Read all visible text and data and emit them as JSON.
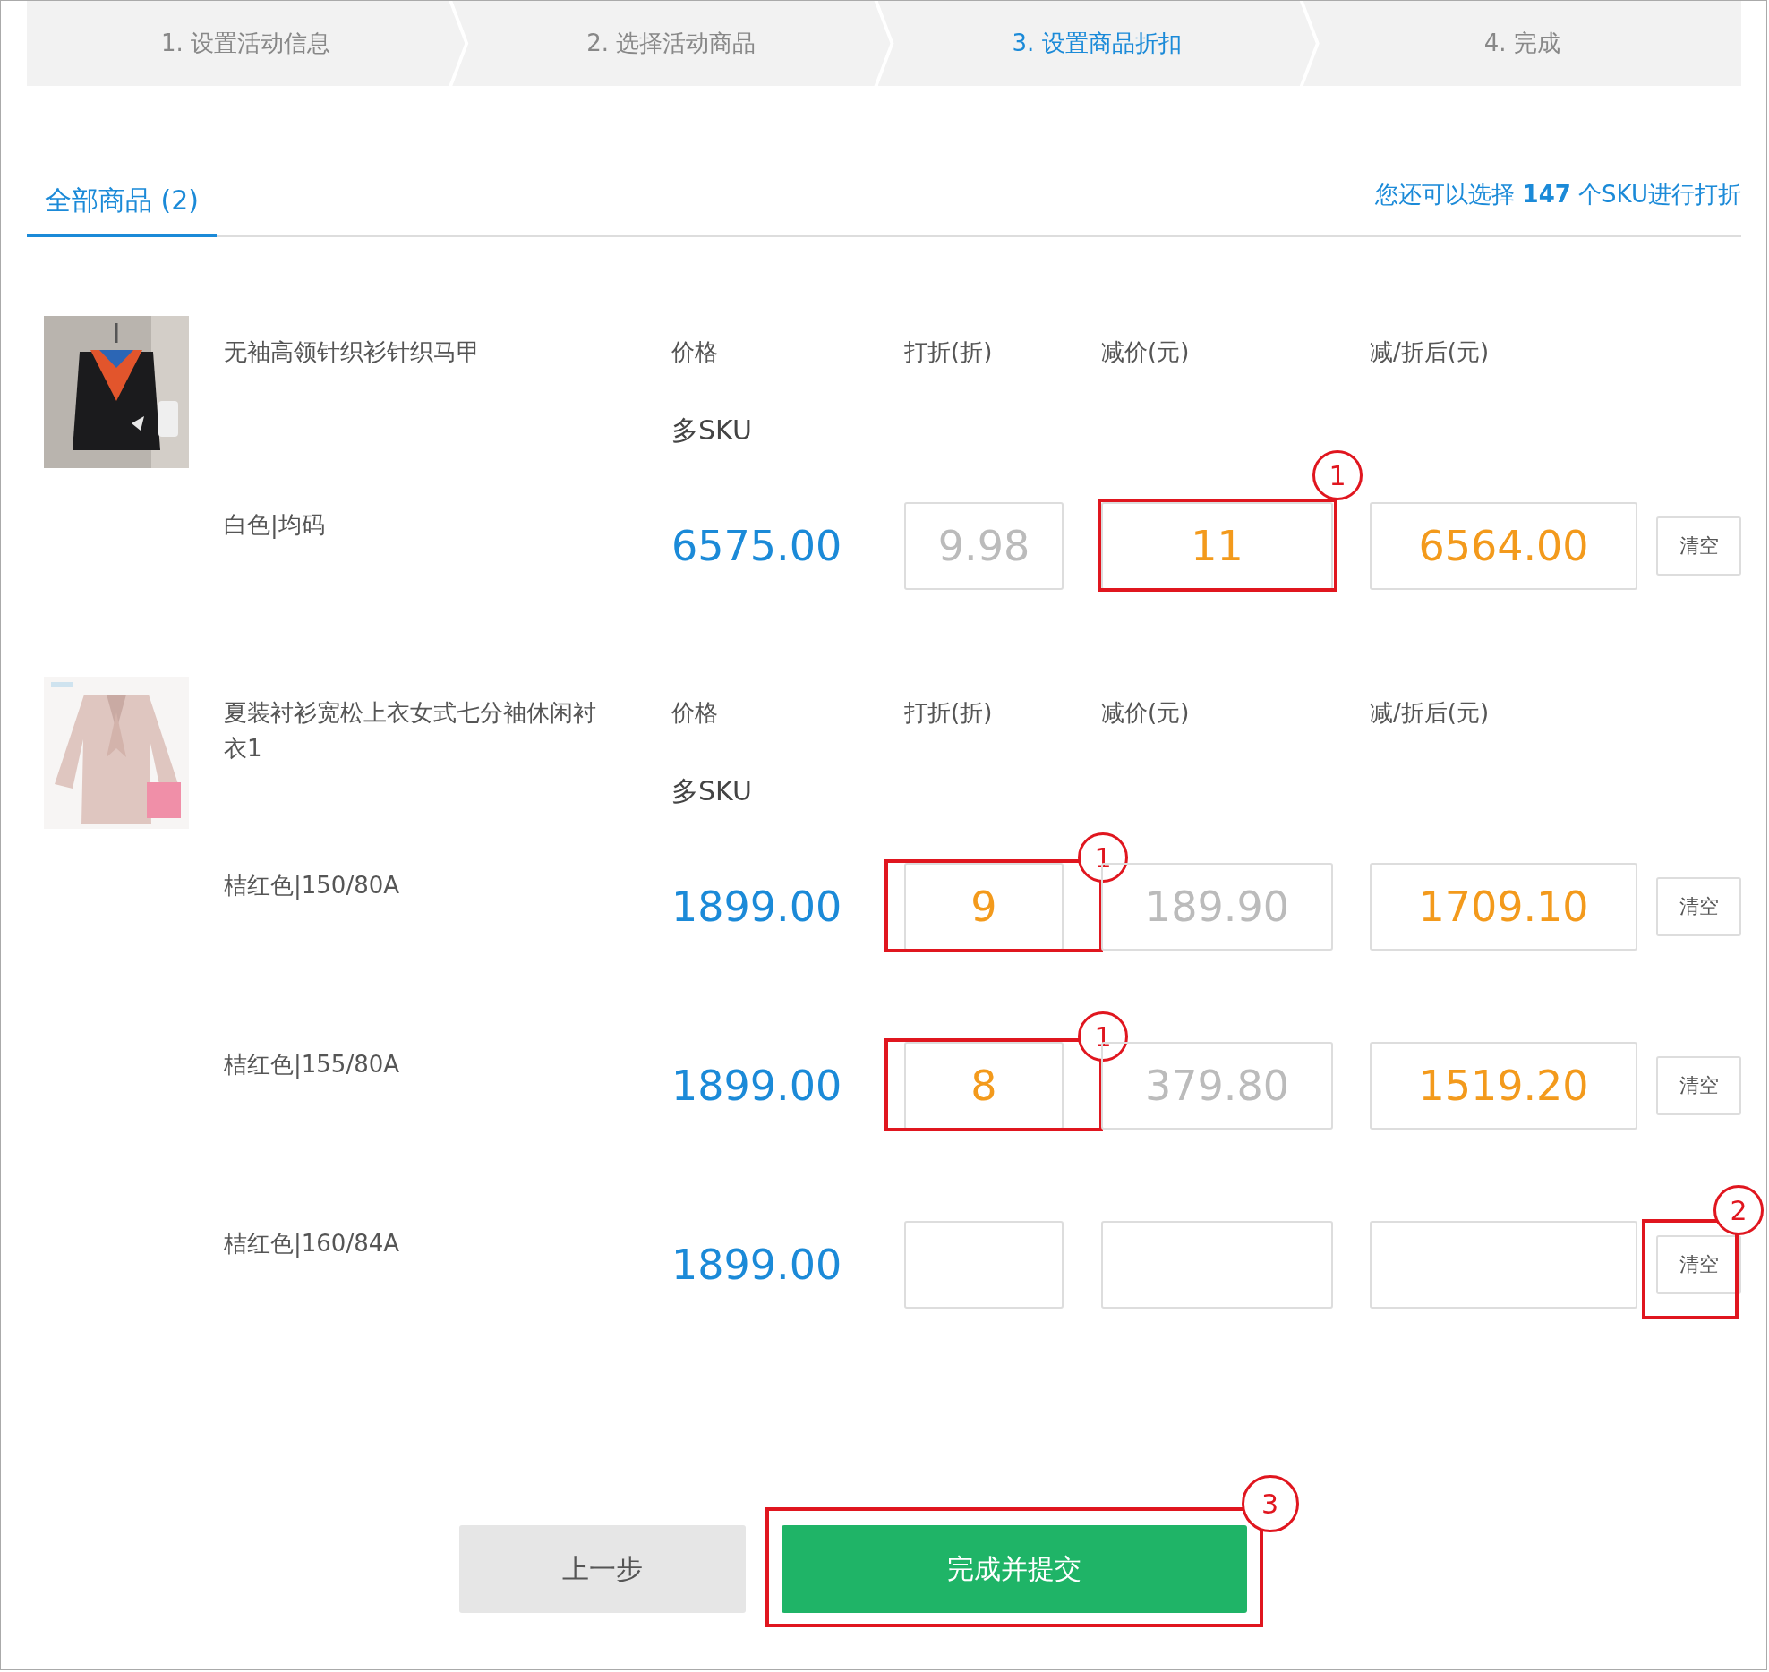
{
  "steps": [
    {
      "label": "1. 设置活动信息",
      "selected": false
    },
    {
      "label": "2. 选择活动商品",
      "selected": false
    },
    {
      "label": "3. 设置商品折扣",
      "selected": true
    },
    {
      "label": "4. 完成",
      "selected": false
    }
  ],
  "tabs": [
    {
      "label": "全部商品 (2)",
      "selected": true
    }
  ],
  "quota_note": "您还可以选择 **147** 个SKU进行打折",
  "products": [
    {
      "name": "无袖高领针织衫针织马甲",
      "columns": [
        "价格",
        "打折(折)",
        "减价(元)",
        "减/折后(元)"
      ],
      "sku_note": "多SKU",
      "skus": [
        {
          "spec": "白色|均码",
          "price": "6575.00",
          "discount": {
            "value": "9.98",
            "entered": false
          },
          "reduction": {
            "value": "11",
            "entered": true,
            "annotation": "1"
          },
          "final": {
            "value": "6564.00",
            "entered": true
          },
          "clear": {
            "label": "清空"
          }
        }
      ]
    },
    {
      "name": "夏装衬衫宽松上衣女式七分袖休闲衬衣1",
      "columns": [
        "价格",
        "打折(折)",
        "减价(元)",
        "减/折后(元)"
      ],
      "sku_note": "多SKU",
      "skus": [
        {
          "spec": "桔红色|150/80A",
          "price": "1899.00",
          "discount": {
            "value": "9",
            "entered": true,
            "annotation": "1"
          },
          "reduction": {
            "value": "189.90",
            "entered": false
          },
          "final": {
            "value": "1709.10",
            "entered": true
          },
          "clear": {
            "label": "清空"
          }
        },
        {
          "spec": "桔红色|155/80A",
          "price": "1899.00",
          "discount": {
            "value": "8",
            "entered": true,
            "annotation": "1"
          },
          "reduction": {
            "value": "379.80",
            "entered": false
          },
          "final": {
            "value": "1519.20",
            "entered": true
          },
          "clear": {
            "label": "清空"
          }
        },
        {
          "spec": "桔红色|160/84A",
          "price": "1899.00",
          "clear": {
            "label": "清空",
            "annotation": "2"
          }
        }
      ]
    }
  ],
  "buttons": [
    {
      "label": "上一步",
      "kind": "secondary"
    },
    {
      "label": "完成并提交",
      "kind": "primary",
      "annotation": "3"
    }
  ]
}
